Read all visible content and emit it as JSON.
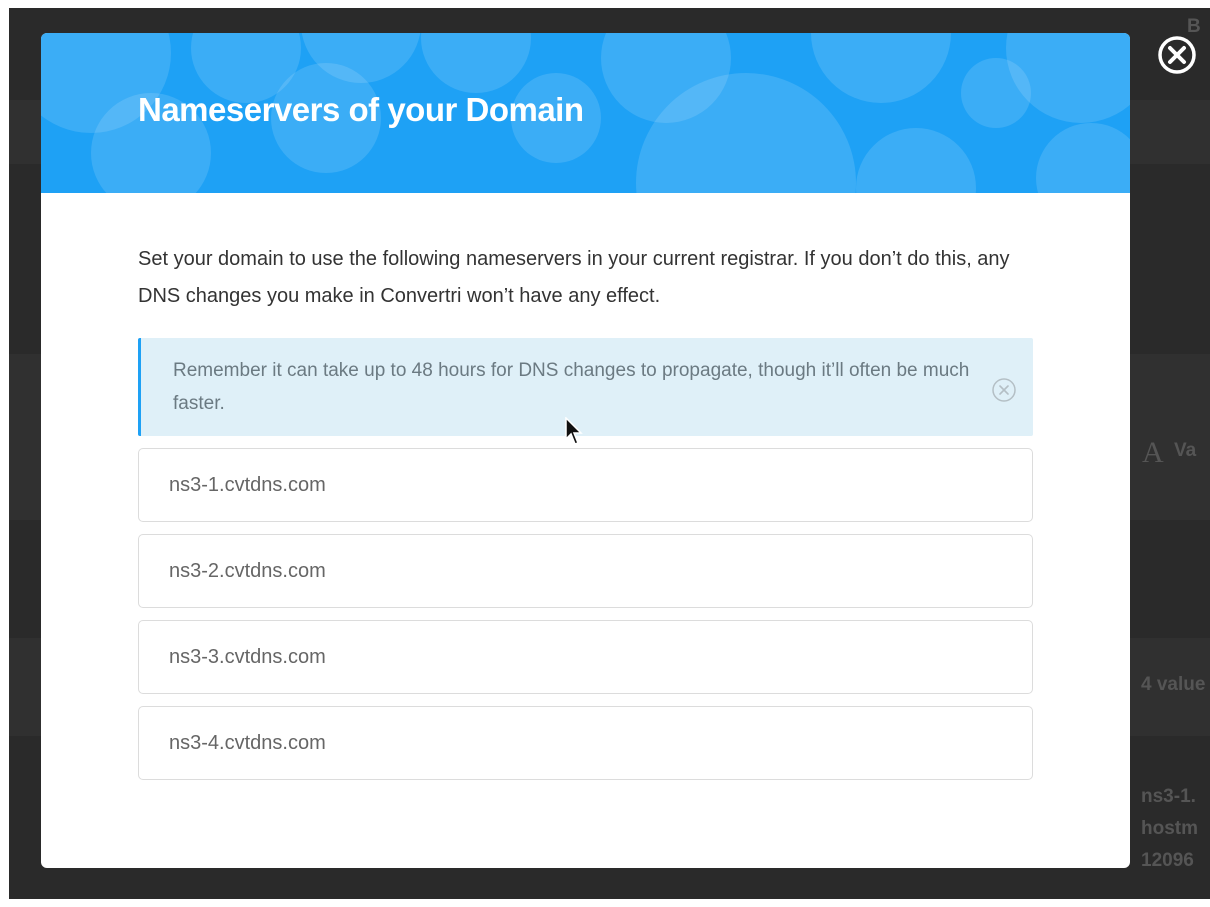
{
  "modal": {
    "title": "Nameservers of your Domain",
    "intro": "Set your domain to use the following nameservers in your current registrar. If you don’t do this, any DNS changes you make in Convertri won’t have any effect.",
    "notice": "Remember it can take up to 48 hours for DNS changes to propagate, though it’ll often be much faster.",
    "nameservers": [
      "ns3-1.cvtdns.com",
      "ns3-2.cvtdns.com",
      "ns3-3.cvtdns.com",
      "ns3-4.cvtdns.com"
    ]
  },
  "background": {
    "value_header": "Va",
    "values_count": "4 value",
    "record_lines": [
      "ns3-1.",
      "hostm",
      "12096"
    ],
    "top_right": "B"
  },
  "colors": {
    "header_blue": "#1ea1f5",
    "notice_bg": "#dff0f8",
    "overlay": "#2a2a2a"
  },
  "icons": {
    "close": "close-circle-icon",
    "notice_close": "close-circle-icon",
    "column_icon": "font-a-icon",
    "cursor": "mouse-pointer-icon"
  }
}
